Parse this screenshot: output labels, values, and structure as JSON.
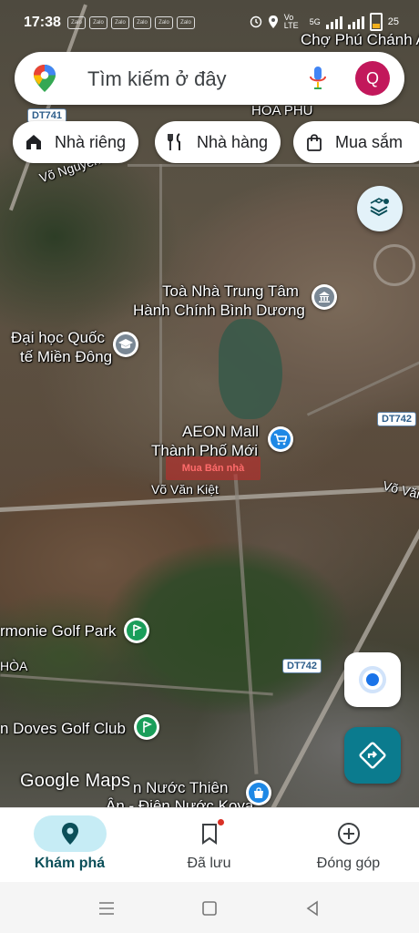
{
  "status_bar": {
    "time": "17:38",
    "zalo_icons": [
      "Zalo",
      "Zalo",
      "Zalo",
      "Zalo",
      "Zalo",
      "Zalo"
    ],
    "network": "Vo LTE",
    "network_type": "5G",
    "battery_level": "25"
  },
  "search": {
    "placeholder": "Tìm kiếm ở đây",
    "avatar_letter": "Q"
  },
  "chips": [
    {
      "label": "Nhà riêng",
      "icon": "home-icon"
    },
    {
      "label": "Nhà hàng",
      "icon": "restaurant-icon"
    },
    {
      "label": "Mua sắm",
      "icon": "shopping-bag-icon"
    }
  ],
  "map": {
    "labels": {
      "market": "Chợ Phú Chánh A",
      "area_hoa_phu": "HÒA PHÚ",
      "street_vo_nguyen": "Võ Nguyên",
      "admin_center_line1": "Toà Nhà Trung Tâm",
      "admin_center_line2": "Hành Chính Bình Dương",
      "university_line1": "Đại học Quốc",
      "university_line2": "tế Miền Đông",
      "aeon_line1": "AEON Mall",
      "aeon_line2": "Thành Phố Mới",
      "street_vo_van_kiet": "Võ Văn Kiệt",
      "street_vo_van_right": "Võ Văn",
      "golf_harmonie": "rmonie Golf Park",
      "golf_doves": "n Doves Golf Club",
      "area_hoa_left": "HÒA",
      "water_line1": "n Nước Thiên",
      "water_line2": "Ân - Điện Nước Koya",
      "watermark_line1": "Mua",
      "watermark_line2": "Bán nhà"
    },
    "road_shields": {
      "dt741": "DT741",
      "dt742_top": "DT742",
      "dt742_bottom": "DT742"
    },
    "attribution": "Google Maps"
  },
  "bottom_nav": [
    {
      "label": "Khám phá",
      "icon": "explore-pin-icon",
      "active": true
    },
    {
      "label": "Đã lưu",
      "icon": "bookmark-icon",
      "active": false
    },
    {
      "label": "Đóng góp",
      "icon": "add-circle-icon",
      "active": false
    }
  ],
  "colors": {
    "accent_teal": "#0b7b8e",
    "active_pill": "#c6ecf5",
    "avatar": "#c2185b",
    "location_blue": "#1a73e8"
  }
}
